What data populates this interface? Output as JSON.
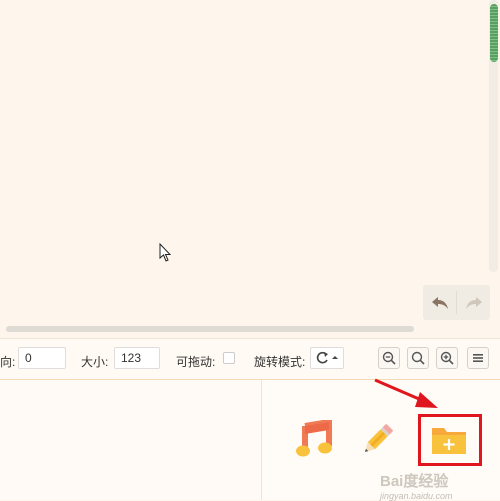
{
  "toolbar": {
    "direction_label": "向:",
    "direction_value": "0",
    "size_label": "大小:",
    "size_value": "123",
    "draggable_label": "可拖动:",
    "rotate_label": "旋转模式:"
  },
  "icons": {
    "undo": "undo-icon",
    "redo": "redo-icon",
    "rotate": "rotate-icon",
    "zoom_out": "zoom-out-icon",
    "zoom_reset": "zoom-reset-icon",
    "zoom_in": "zoom-in-icon",
    "menu": "menu-icon",
    "music": "music-icon",
    "pencil": "pencil-icon",
    "folder_add": "folder-add-icon"
  },
  "colors": {
    "canvas_bg": "#fef6ec",
    "scroll_thumb": "#5a9e62",
    "highlight_box": "#e0161e",
    "music_icon": "#f07a55",
    "folder_icon": "#f9c23c"
  },
  "watermark": {
    "brand": "Bai度经验",
    "url": "jingyan.baidu.com"
  }
}
